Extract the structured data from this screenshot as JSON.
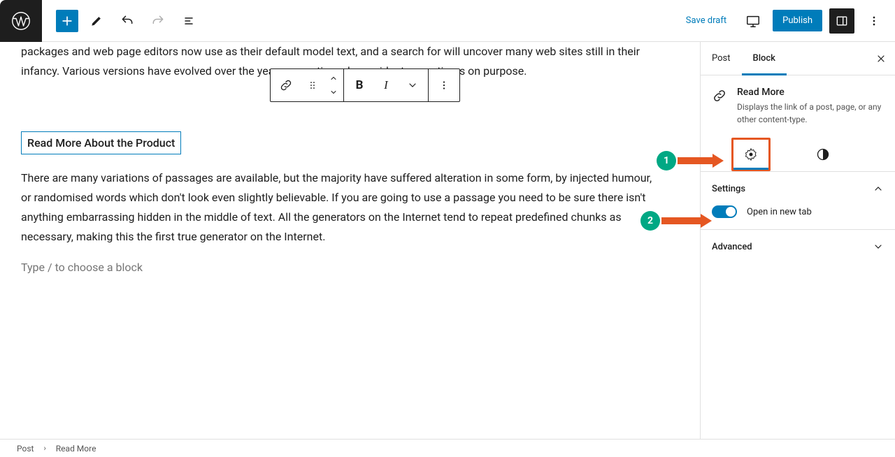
{
  "topbar": {
    "save_draft": "Save draft",
    "publish": "Publish"
  },
  "editor": {
    "para1": "packages and web page editors now use as their default model text, and a search for will uncover many web sites still in their infancy. Various versions have evolved over the years, sometimes by accident, sometimes on purpose.",
    "para1_visible_prefix": "packages and web page editors now use as their default model text, and a search for will uncover many web sites still in their infancy. Various versions have evolved ove",
    "para1_visible_suffix": "sometimes on purpose.",
    "readmore_text": "Read More About the Product",
    "para2": "There are many variations of passages are available, but the majority have suffered alteration in some form, by injected humour, or randomised words which don't look even slightly believable. If you are going to use a passage you need to be sure there isn't anything embarrassing hidden in the middle of text. All the generators on the Internet tend to repeat predefined chunks as necessary, making this the first true generator on the Internet.",
    "placeholder": "Type / to choose a block"
  },
  "block_toolbar": {
    "bold": "B",
    "italic": "I"
  },
  "sidebar": {
    "tabs": {
      "post": "Post",
      "block": "Block"
    },
    "block_name": "Read More",
    "block_desc": "Displays the link of a post, page, or any other content-type.",
    "section_settings": "Settings",
    "open_new_tab": "Open in new tab",
    "section_advanced": "Advanced"
  },
  "breadcrumb": {
    "root": "Post",
    "current": "Read More"
  },
  "callouts": {
    "one": "1",
    "two": "2"
  }
}
